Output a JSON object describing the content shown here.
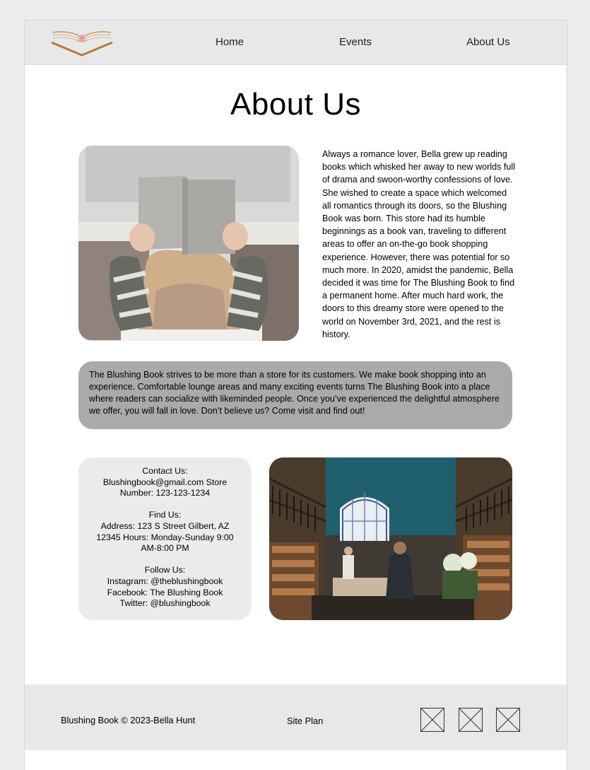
{
  "nav": {
    "items": [
      {
        "label": "Home"
      },
      {
        "label": "Events"
      },
      {
        "label": "About Us"
      }
    ]
  },
  "page": {
    "title": "About Us"
  },
  "story": {
    "text": "Always a romance lover, Bella grew up reading books which whisked her away to new worlds full of drama and swoon-worthy confessions of love. She wished to create a space which welcomed all romantics through its doors, so the Blushing Book was born. This store had its humble beginnings as a book van, traveling to different areas to offer an on-the-go book shopping experience. However, there was potential for so much more. In 2020, amidst the pandemic, Bella decided it was time for The Blushing Book to find a permanent home. After much hard work, the doors to this dreamy store were opened to the world on November 3rd, 2021, and the rest is history."
  },
  "mission": {
    "text": "The Blushing Book strives to be more than a store for its customers. We make book shopping into an experience. Comfortable lounge areas and many exciting events turns The Blushing Book into a place where readers can socialize with likeminded people. Once you’ve experienced the delightful atmosphere we offer, you will fall in love. Don’t believe us? Come visit and find out!"
  },
  "contact": {
    "contact_heading": "Contact Us:",
    "contact_text": "Blushingbook@gmail.com Store Number: 123-123-1234",
    "find_heading": "Find Us:",
    "find_text": "Address: 123 S Street Gilbert, AZ 12345 Hours: Monday-Sunday 9:00 AM-8:00 PM",
    "follow_heading": "Follow Us:",
    "instagram": "Instagram: @theblushingbook",
    "facebook": "Facebook: The Blushing Book",
    "twitter": "Twitter: @blushingbook"
  },
  "footer": {
    "copyright": "Blushing Book © 2023-Bella Hunt",
    "site_plan": "Site Plan",
    "social_icons": [
      "placeholder-icon",
      "placeholder-icon",
      "placeholder-icon"
    ]
  },
  "colors": {
    "header_bg": "#e8e8e8",
    "mission_bg": "#aaaaaa",
    "card_bg": "#ebebeb",
    "logo_gold": "#c8965a",
    "logo_pink": "#f2a7b8"
  },
  "icons": {
    "logo": "open-book-logo-icon"
  }
}
